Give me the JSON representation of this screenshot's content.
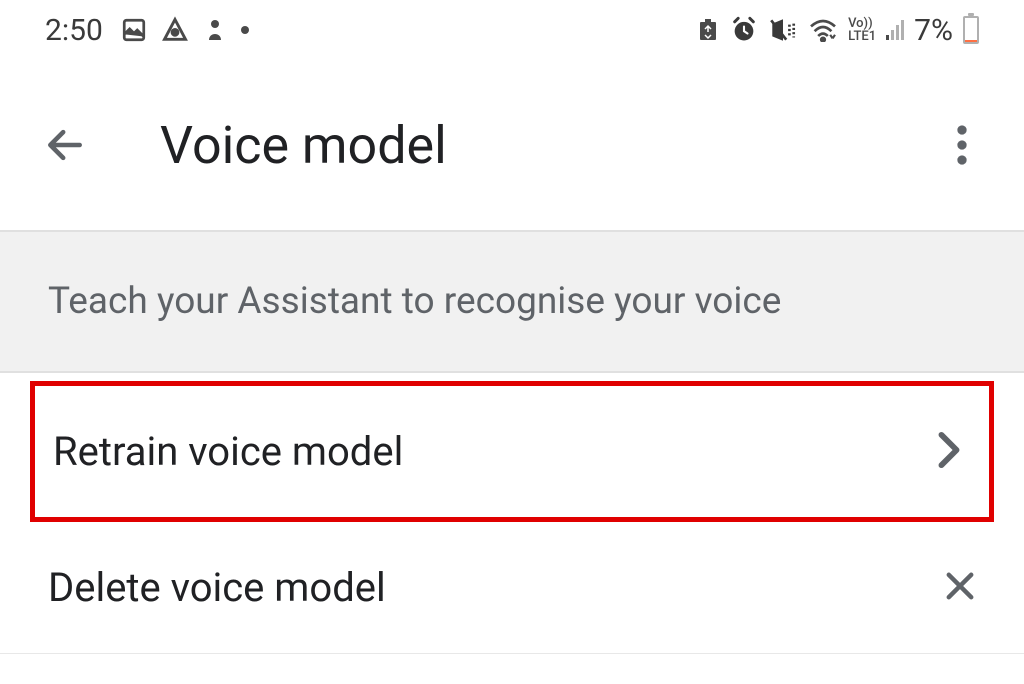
{
  "statusBar": {
    "time": "2:50",
    "battery": "7%"
  },
  "appBar": {
    "title": "Voice model"
  },
  "section": {
    "header": "Teach your Assistant to recognise your voice"
  },
  "items": {
    "retrain": "Retrain voice model",
    "delete": "Delete voice model"
  }
}
